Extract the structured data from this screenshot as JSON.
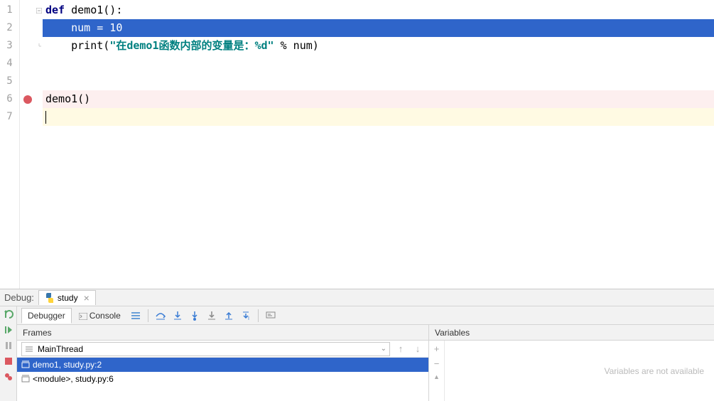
{
  "editor": {
    "lines": {
      "l1a": "def",
      "l1b": " demo1():",
      "l2": "    num = 10",
      "l3a": "    print(",
      "l3b": "\"在demo1函数内部的变量是：%d\"",
      "l3c": " % num)",
      "l6": "demo1()"
    },
    "line_numbers": [
      "1",
      "2",
      "3",
      "4",
      "5",
      "6",
      "7"
    ]
  },
  "debug": {
    "label": "Debug:",
    "tab": "study",
    "tabs": {
      "debugger": "Debugger",
      "console": "Console"
    },
    "frames": {
      "title": "Frames",
      "thread": "MainThread",
      "items": [
        {
          "text": "demo1, study.py:2",
          "selected": true
        },
        {
          "text": "<module>, study.py:6",
          "selected": false
        }
      ]
    },
    "vars": {
      "title": "Variables",
      "placeholder": "Variables are not available"
    }
  }
}
